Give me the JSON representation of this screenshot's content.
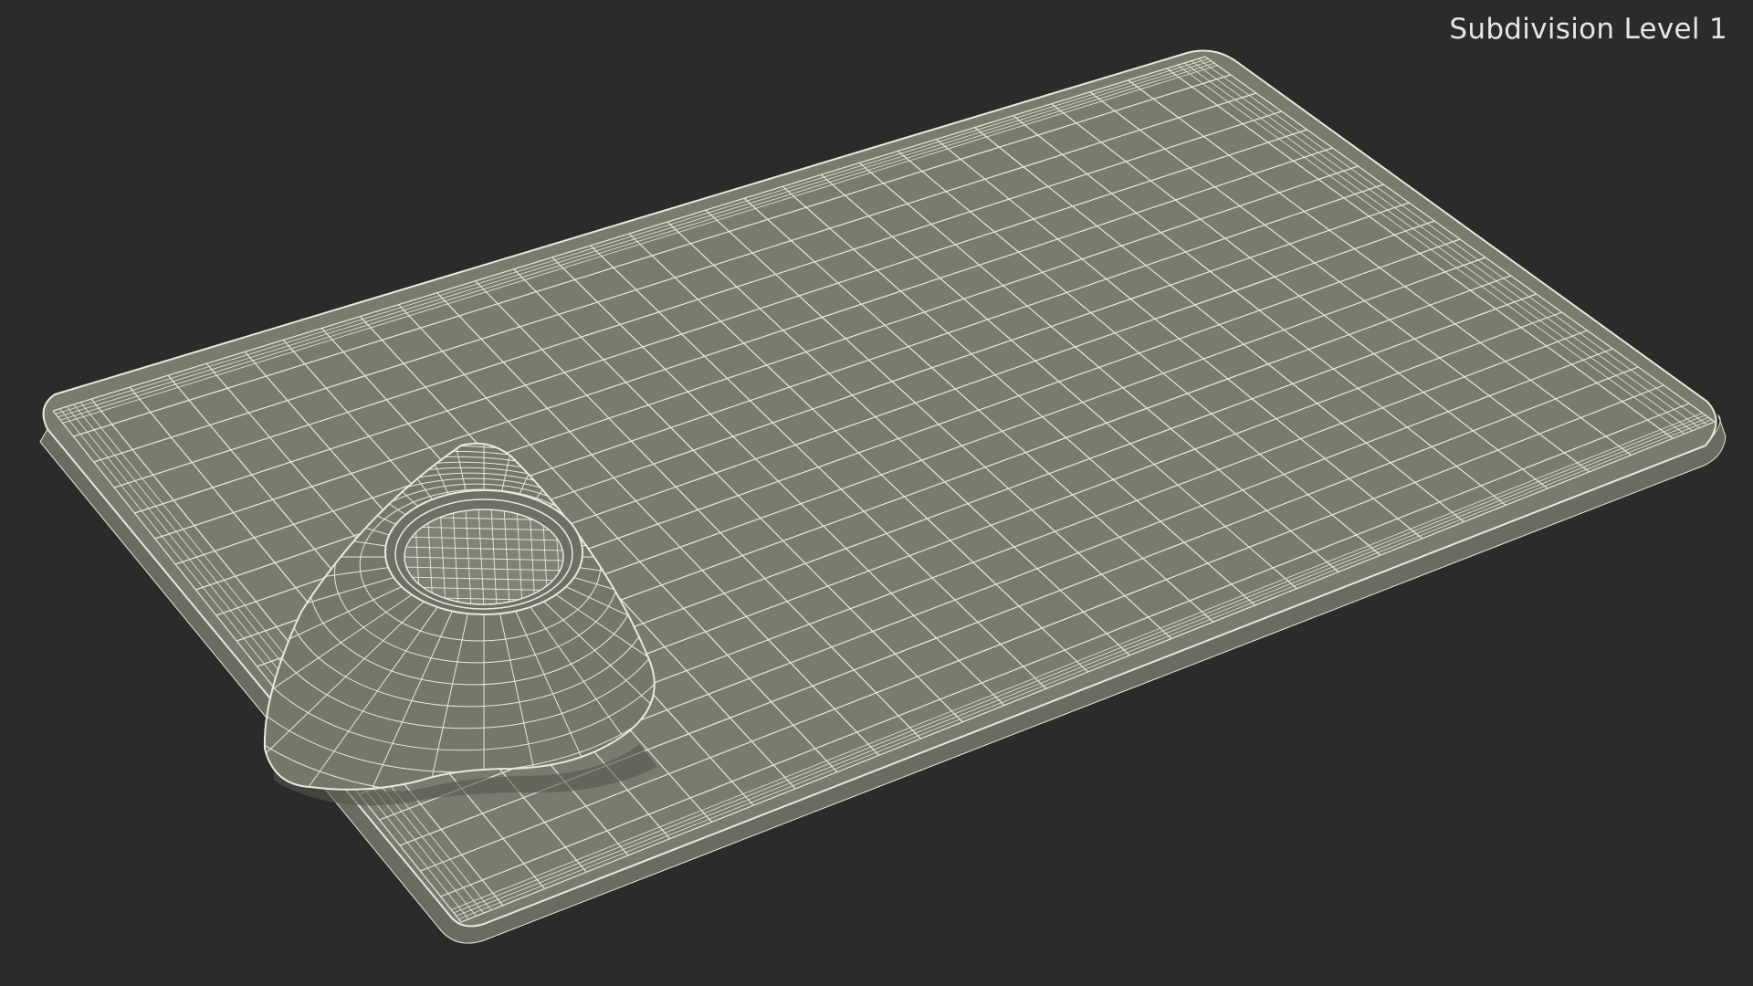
{
  "viewport": {
    "caption": "Subdivision Level 1",
    "background_color": "#2b2b2b"
  },
  "model": {
    "board_color": "#7a7a6f",
    "pick_color": "#767669",
    "wire_color": "#e8e8dc"
  }
}
